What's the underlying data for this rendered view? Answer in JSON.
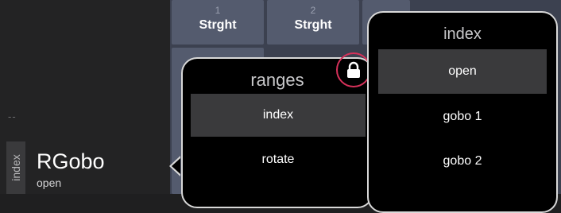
{
  "left_panel": {
    "dashes": "--",
    "tab_label": "index",
    "param_name": "RGobo",
    "param_value": "open"
  },
  "grid": {
    "cells": [
      {
        "number": "1",
        "label": "Strght"
      },
      {
        "number": "2",
        "label": "Strght"
      }
    ]
  },
  "ranges_popup": {
    "title": "ranges",
    "items": [
      "index",
      "rotate"
    ],
    "selected": "index",
    "lock_icon": "lock-icon"
  },
  "index_popup": {
    "title": "index",
    "items": [
      "open",
      "gobo 1",
      "gobo 2"
    ],
    "selected": "open"
  },
  "colors": {
    "highlight_ring": "#d6315a",
    "selected_row": "#3a3a3c"
  }
}
